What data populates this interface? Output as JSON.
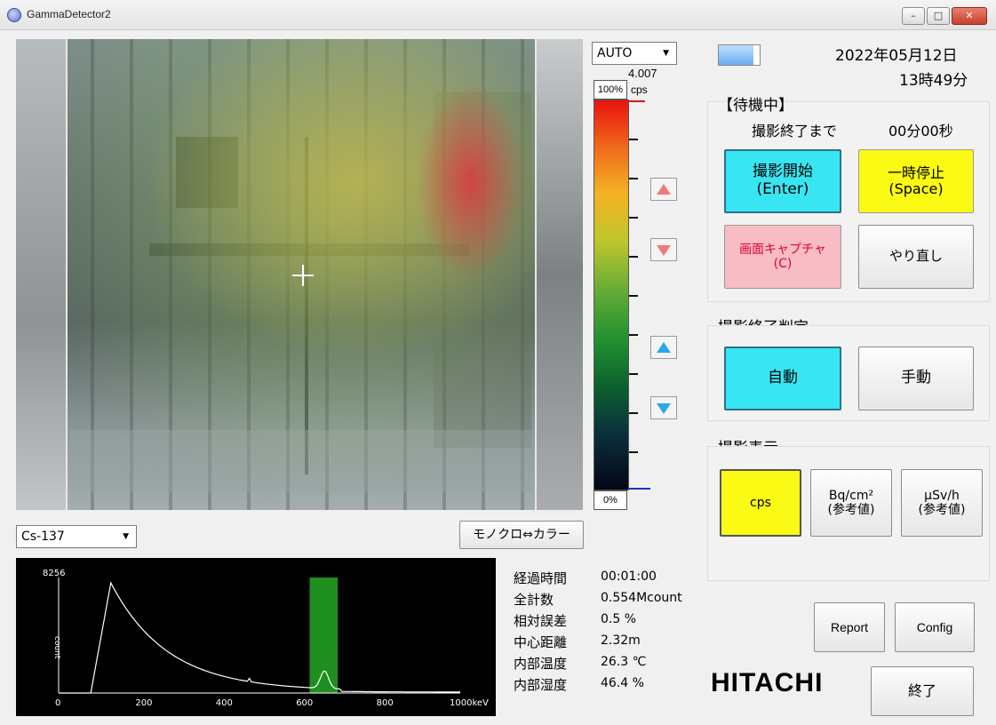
{
  "window": {
    "title": "GammaDetector2",
    "icon": "app-globe-icon",
    "minimize_label": "–",
    "maximize_label": "□",
    "close_label": "✕"
  },
  "camera": {
    "crosshair_icon": "crosshair-icon"
  },
  "scale": {
    "mode_options": [
      "AUTO"
    ],
    "mode_selected": "AUTO",
    "max_value": "4.007",
    "unit": "cps",
    "top_label": "100%",
    "bottom_label": "0%"
  },
  "nuclide": {
    "selected": "Cs-137"
  },
  "mono_color_button": "モノクロ⇔カラー",
  "spectrum": {
    "ymax_label": "8256",
    "ylabel": "count",
    "xticks": [
      "0",
      "200",
      "400",
      "600",
      "800",
      "1000keV"
    ],
    "x_range": [
      0,
      1000
    ],
    "roi_range": [
      625,
      695
    ],
    "roi_color": "#1f8f1f",
    "line_color": "#ffffff"
  },
  "stats": [
    {
      "label": "経過時間",
      "value": "00:01:00"
    },
    {
      "label": "全計数",
      "value": "0.554Mcount"
    },
    {
      "label": "相対誤差",
      "value": "0.5 %"
    },
    {
      "label": "中心距離",
      "value": "2.32m"
    },
    {
      "label": "内部温度",
      "value": "26.3 ℃"
    },
    {
      "label": "内部湿度",
      "value": "46.4 %"
    }
  ],
  "header": {
    "date": "2022年05月12日",
    "time": "13時49分",
    "progress_fraction": 0.85
  },
  "status": {
    "state": "【待機中】",
    "remaining_label": "撮影終了まで",
    "remaining_value": "00分00秒",
    "start_line1": "撮影開始",
    "start_line2": "(Enter)",
    "pause_line1": "一時停止",
    "pause_line2": "(Space)",
    "capture_line1": "画面キャプチャ",
    "capture_line2": "(C)",
    "redo": "やり直し"
  },
  "end_judgement": {
    "title": "撮影終了判定",
    "auto": "自動",
    "manual": "手動"
  },
  "display": {
    "title": "撮影表示",
    "cps": "cps",
    "bq_line1": "Bq/cm²",
    "bq_line2": "(参考値)",
    "usv_line1": "μSv/h",
    "usv_line2": "(参考値)"
  },
  "footer": {
    "report": "Report",
    "config": "Config",
    "brand": "HITACHI",
    "exit": "終了"
  },
  "colors": {
    "accent_cyan": "#38e6f2",
    "accent_yellow": "#fafa14",
    "accent_pink": "#f7bcc4",
    "capture_text": "#e4002b"
  }
}
